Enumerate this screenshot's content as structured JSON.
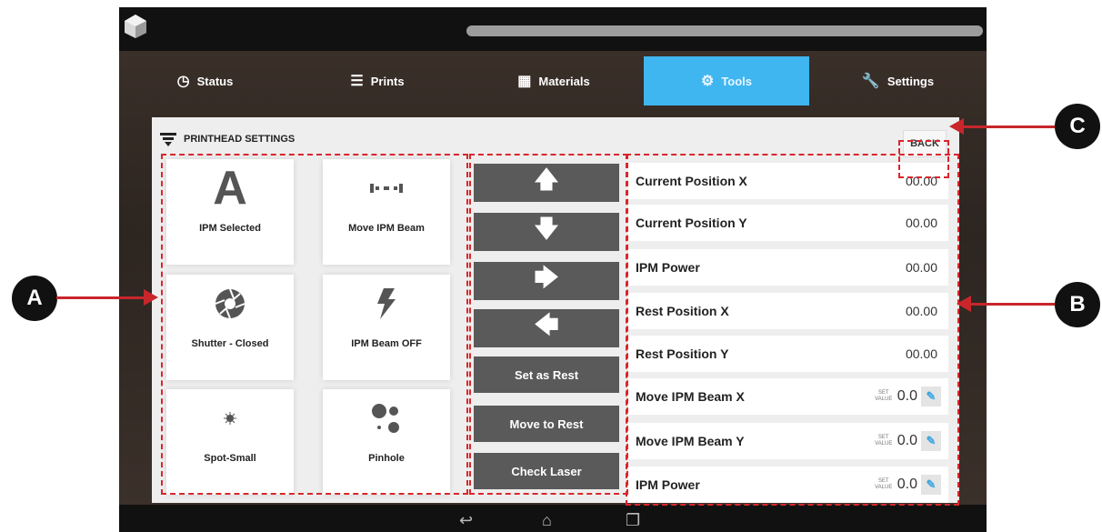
{
  "tabs": [
    {
      "label": "Status",
      "icon": "clock-icon"
    },
    {
      "label": "Prints",
      "icon": "list-icon"
    },
    {
      "label": "Materials",
      "icon": "checkered-icon"
    },
    {
      "label": "Tools",
      "icon": "gear-icon",
      "active": true
    },
    {
      "label": "Settings",
      "icon": "wrench-icon"
    }
  ],
  "panel": {
    "title": "PRINTHEAD SETTINGS",
    "back_label": "BACK"
  },
  "tiles": [
    {
      "label": "IPM Selected",
      "glyph": "A"
    },
    {
      "label": "Move IPM Beam"
    },
    {
      "label": "Shutter - Closed"
    },
    {
      "label": "IPM Beam OFF"
    },
    {
      "label": "Spot-Small"
    },
    {
      "label": "Pinhole"
    }
  ],
  "buttons": {
    "set_rest": "Set as Rest",
    "move_rest": "Move to Rest",
    "check_laser": "Check Laser"
  },
  "rows": [
    {
      "label": "Current Position X",
      "value": "00.00"
    },
    {
      "label": "Current Position Y",
      "value": "00.00"
    },
    {
      "label": "IPM Power",
      "value": "00.00"
    },
    {
      "label": "Rest Position X",
      "value": "00.00"
    },
    {
      "label": "Rest Position Y",
      "value": "00.00"
    },
    {
      "label": "Move IPM Beam X",
      "value": "0.0",
      "set_label": "SET VALUE"
    },
    {
      "label": "Move IPM Beam Y",
      "value": "0.0",
      "set_label": "SET VALUE"
    },
    {
      "label": "IPM Power",
      "value": "0.0",
      "set_label": "SET VALUE"
    }
  ],
  "callouts": {
    "a": "A",
    "b": "B",
    "c": "C"
  },
  "colors": {
    "accent": "#3fb6f0",
    "callout_red": "#d9262c",
    "button_dark": "#5a5a5a"
  }
}
